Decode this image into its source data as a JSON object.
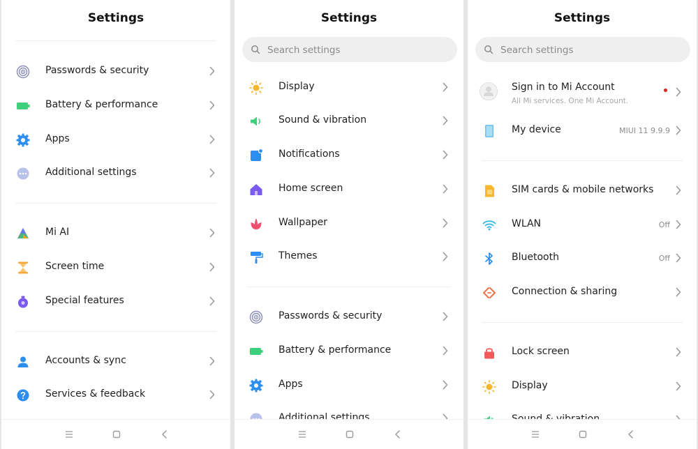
{
  "colors": {
    "background": "#e5e5e5",
    "panel": "#ffffff",
    "divider": "#ececec",
    "search_bg": "#efefef",
    "text": "#1f1f1f",
    "secondary_text": "#8c8c8c"
  },
  "screen1": {
    "title": "Settings",
    "group1": [
      {
        "label": "Passwords & security",
        "icon": "fingerprint-icon"
      },
      {
        "label": "Battery & performance",
        "icon": "battery-icon"
      },
      {
        "label": "Apps",
        "icon": "gear-icon"
      },
      {
        "label": "Additional settings",
        "icon": "more-dots-icon"
      }
    ],
    "group2": [
      {
        "label": "Mi AI",
        "icon": "mi-ai-icon"
      },
      {
        "label": "Screen time",
        "icon": "hourglass-icon"
      },
      {
        "label": "Special features",
        "icon": "special-features-icon"
      }
    ],
    "group3": [
      {
        "label": "Accounts & sync",
        "icon": "person-icon"
      },
      {
        "label": "Services & feedback",
        "icon": "help-icon"
      }
    ]
  },
  "screen2": {
    "title": "Settings",
    "search_placeholder": "Search settings",
    "group1": [
      {
        "label": "Display",
        "icon": "sun-icon"
      },
      {
        "label": "Sound & vibration",
        "icon": "speaker-icon"
      },
      {
        "label": "Notifications",
        "icon": "notification-icon"
      },
      {
        "label": "Home screen",
        "icon": "home-icon"
      },
      {
        "label": "Wallpaper",
        "icon": "flower-icon"
      },
      {
        "label": "Themes",
        "icon": "paint-roller-icon"
      }
    ],
    "group2": [
      {
        "label": "Passwords & security",
        "icon": "fingerprint-icon"
      },
      {
        "label": "Battery & performance",
        "icon": "battery-icon"
      },
      {
        "label": "Apps",
        "icon": "gear-icon"
      },
      {
        "label": "Additional settings",
        "icon": "more-dots-icon"
      }
    ]
  },
  "screen3": {
    "title": "Settings",
    "search_placeholder": "Search settings",
    "account": {
      "label": "Sign in to Mi Account",
      "sub": "All Mi services. One Mi Account.",
      "icon": "avatar-icon"
    },
    "device": {
      "label": "My device",
      "value": "MIUI 11 9.9.9",
      "icon": "phone-icon"
    },
    "group1": [
      {
        "label": "SIM cards & mobile networks",
        "value": "",
        "icon": "sim-card-icon"
      },
      {
        "label": "WLAN",
        "value": "Off",
        "icon": "wifi-icon"
      },
      {
        "label": "Bluetooth",
        "value": "Off",
        "icon": "bluetooth-icon"
      },
      {
        "label": "Connection & sharing",
        "value": "",
        "icon": "connection-icon"
      }
    ],
    "group2": [
      {
        "label": "Lock screen",
        "icon": "lock-icon"
      },
      {
        "label": "Display",
        "icon": "sun-icon"
      },
      {
        "label": "Sound & vibration",
        "icon": "speaker-icon"
      }
    ]
  }
}
